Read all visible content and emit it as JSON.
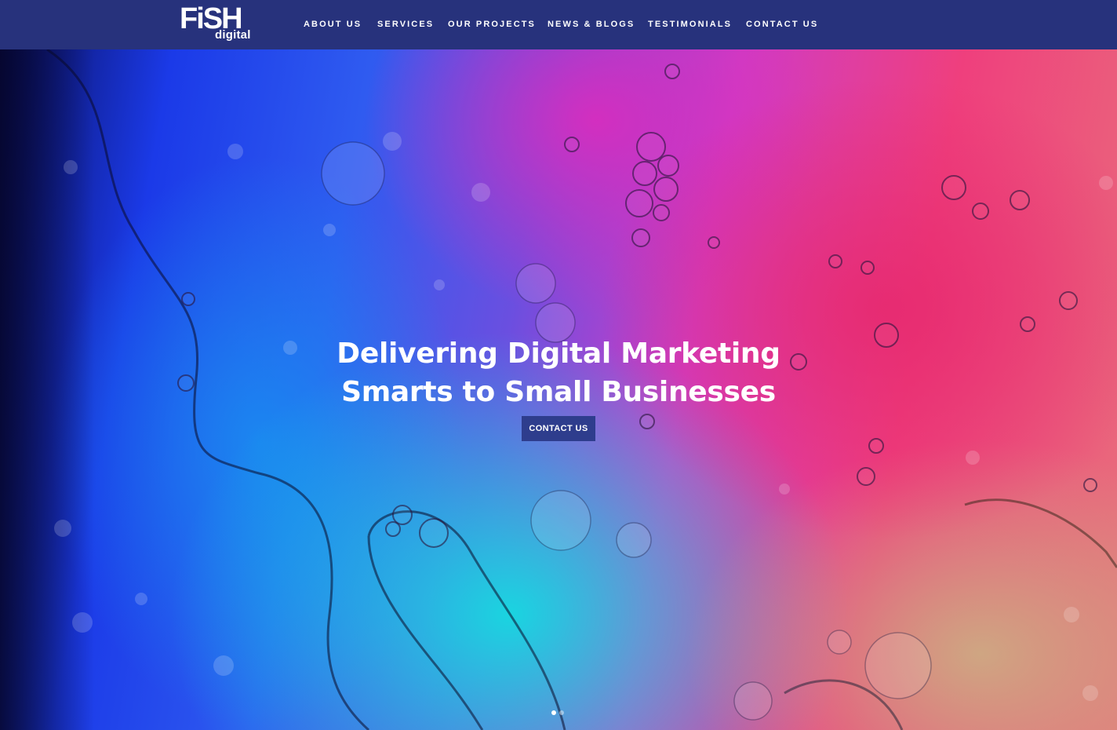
{
  "brand": {
    "name": "FiSH",
    "sub": "digital"
  },
  "nav": {
    "items": [
      {
        "label": "ABOUT US"
      },
      {
        "label": "SERVICES"
      },
      {
        "label": "OUR PROJECTS"
      },
      {
        "label": "NEWS & BLOGS"
      },
      {
        "label": "TESTIMONIALS"
      },
      {
        "label": "CONTACT US"
      }
    ]
  },
  "hero": {
    "headline_line1": "Delivering Digital Marketing",
    "headline_line2": "Smarts to Small Businesses",
    "cta_label": "CONTACT US",
    "slide_count": 2,
    "active_slide": 1
  },
  "colors": {
    "header_bg": "#27327c",
    "cta_bg": "#2e3d8d",
    "text": "#ffffff"
  }
}
